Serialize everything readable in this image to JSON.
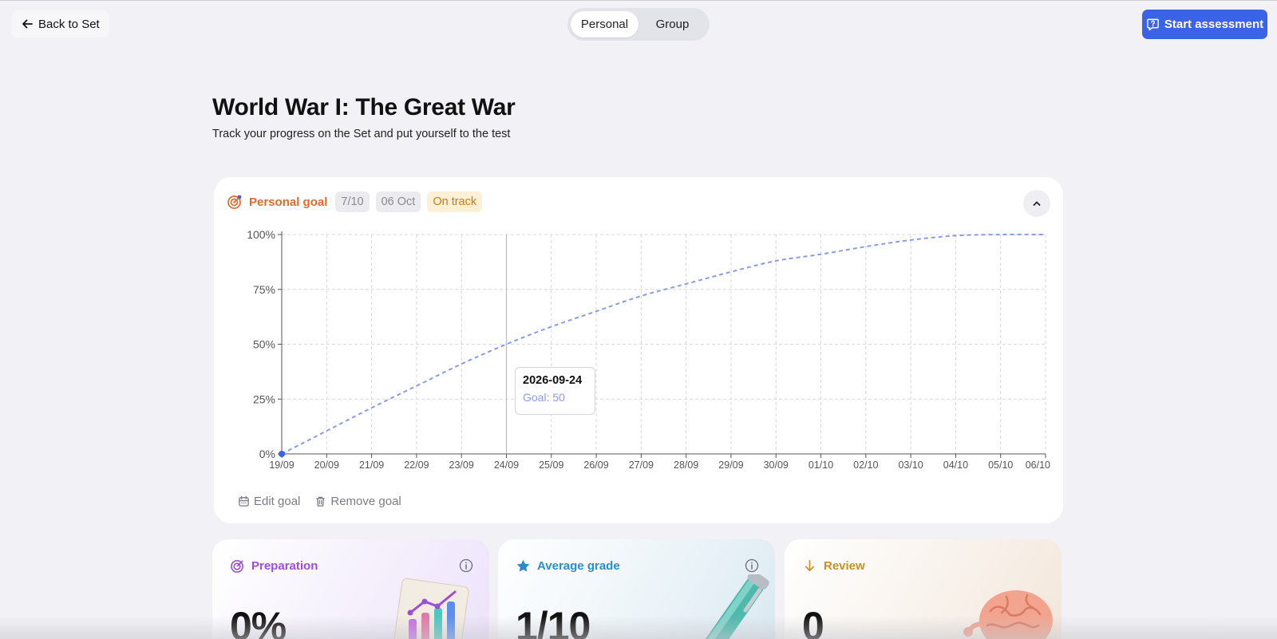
{
  "nav": {
    "back_label": "Back to Set",
    "tabs": [
      {
        "label": "Personal",
        "active": true
      },
      {
        "label": "Group",
        "active": false
      }
    ],
    "start_label": "Start assessment"
  },
  "header": {
    "title": "World War I: The Great War",
    "subtitle": "Track your progress on the Set and put yourself to the test"
  },
  "goal": {
    "label": "Personal goal",
    "score_chip": "7/10",
    "date_chip": "06 Oct",
    "status_chip": "On track",
    "edit_label": "Edit goal",
    "remove_label": "Remove goal",
    "tooltip": {
      "date": "2026-09-24",
      "value": "Goal: 50"
    }
  },
  "chart_data": {
    "type": "line",
    "x": [
      "19/09",
      "20/09",
      "21/09",
      "22/09",
      "23/09",
      "24/09",
      "25/09",
      "26/09",
      "27/09",
      "28/09",
      "29/09",
      "30/09",
      "01/10",
      "02/10",
      "03/10",
      "04/10",
      "05/10",
      "06/10"
    ],
    "series": [
      {
        "values": [
          0,
          10.5,
          21,
          31,
          41,
          50,
          58,
          65,
          72,
          77.5,
          83,
          88,
          91,
          94.5,
          97.5,
          99.5,
          100,
          100
        ]
      }
    ],
    "yticks": [
      "0%",
      "25%",
      "50%",
      "75%",
      "100%"
    ],
    "ylim": [
      0,
      100
    ],
    "highlight_index": 5,
    "grid": true,
    "colors": {
      "line": "#8a9be6",
      "point": "#3a63e8",
      "grid": "#d8d8de"
    }
  },
  "stats": [
    {
      "title": "Preparation",
      "value": "0%",
      "color": "#9b4fd8",
      "icon": "target-icon"
    },
    {
      "title": "Average grade",
      "value": "1/10",
      "color": "#2a8fc9",
      "icon": "star-icon"
    },
    {
      "title": "Review",
      "value": "0",
      "color": "#c79320",
      "icon": "arrow-down-icon"
    }
  ]
}
